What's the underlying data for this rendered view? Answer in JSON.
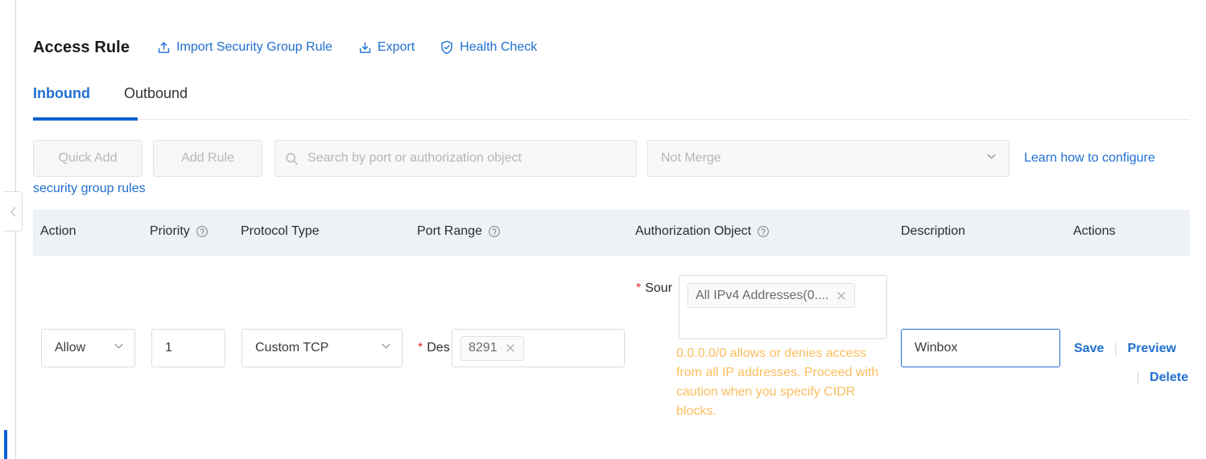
{
  "rail": {
    "collapse_icon": "chevron-left-icon"
  },
  "header": {
    "title": "Access Rule",
    "actions": [
      {
        "label": "Import Security Group Rule",
        "icon": "upload-icon"
      },
      {
        "label": "Export",
        "icon": "download-icon"
      },
      {
        "label": "Health Check",
        "icon": "shield-check-icon"
      }
    ]
  },
  "tabs": [
    {
      "label": "Inbound",
      "active": true
    },
    {
      "label": "Outbound",
      "active": false
    }
  ],
  "toolbar": {
    "quick_add_label": "Quick Add",
    "add_rule_label": "Add Rule",
    "search": {
      "placeholder": "Search by port or authorization object",
      "value": "",
      "icon": "search-icon"
    },
    "merge": {
      "selected": "Not Merge",
      "icon": "chevron-down-icon"
    },
    "learn_link": "Learn how to configure",
    "sg_rules_link": "security group rules"
  },
  "table": {
    "columns": [
      {
        "label": "Action",
        "help": false
      },
      {
        "label": "Priority",
        "help": true
      },
      {
        "label": "Protocol Type",
        "help": false
      },
      {
        "label": "Port Range",
        "help": true
      },
      {
        "label": "Authorization Object",
        "help": true
      },
      {
        "label": "Description",
        "help": false
      },
      {
        "label": "Actions",
        "help": false
      }
    ],
    "help_icon": "question-circle-icon",
    "header_bg": "#eef1f6"
  },
  "rule_row": {
    "action": {
      "value": "Allow",
      "icon": "chevron-down-icon"
    },
    "priority": {
      "value": "1"
    },
    "protocol": {
      "value": "Custom TCP",
      "icon": "chevron-down-icon"
    },
    "dest_label": "Des",
    "dest_required": "*",
    "port_tag": {
      "label": "8291",
      "remove_icon": "close-icon"
    },
    "source_label": "Sour",
    "source_required": "*",
    "source_tag": {
      "label": "All IPv4 Addresses(0....",
      "remove_icon": "close-icon"
    },
    "warning": "0.0.0.0/0 allows or denies access from all IP addresses. Proceed with caution when you specify CIDR blocks.",
    "warning_color": "#fbbd5e",
    "description": {
      "value": "Winbox"
    },
    "actions": {
      "save": "Save",
      "preview": "Preview",
      "delete": "Delete",
      "separator": "|"
    }
  },
  "colors": {
    "link": "#1f6fd0",
    "accent": "#0b63cf",
    "required": "#d93026"
  }
}
